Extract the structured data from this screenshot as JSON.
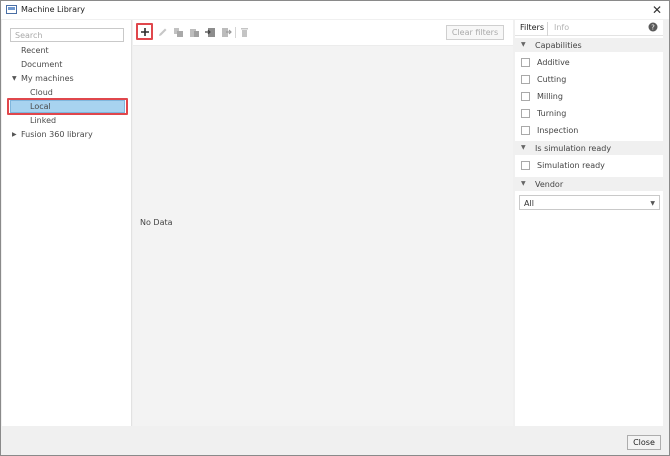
{
  "window": {
    "title": "Machine Library",
    "close_glyph": "✕"
  },
  "left": {
    "search": {
      "placeholder": "Search",
      "value": ""
    },
    "tree": [
      {
        "label": "Recent"
      },
      {
        "label": "Document"
      },
      {
        "label": "My machines",
        "expanded": true
      },
      {
        "label": "Cloud"
      },
      {
        "label": "Local",
        "selected": true
      },
      {
        "label": "Linked"
      },
      {
        "label": "Fusion 360 library",
        "expanded": false
      }
    ]
  },
  "toolbar": {
    "icons": [
      "add-icon",
      "edit-icon",
      "duplicate-icon",
      "paste-icon",
      "import-icon",
      "export-icon",
      "delete-icon"
    ],
    "clear_filters_label": "Clear filters"
  },
  "center": {
    "empty_text": "No Data"
  },
  "right": {
    "tabs": [
      {
        "label": "Filters",
        "active": true
      },
      {
        "label": "Info",
        "active": false
      }
    ],
    "sections": {
      "capabilities": "Capabilities",
      "simulation": "Is simulation ready",
      "vendor": "Vendor"
    },
    "capabilities": [
      "Additive",
      "Cutting",
      "Milling",
      "Turning",
      "Inspection"
    ],
    "simulation_option": "Simulation ready",
    "vendor_value": "All"
  },
  "footer": {
    "close_label": "Close"
  },
  "colors": {
    "selection": "#a8d3f0",
    "highlight": "#e0474c"
  }
}
